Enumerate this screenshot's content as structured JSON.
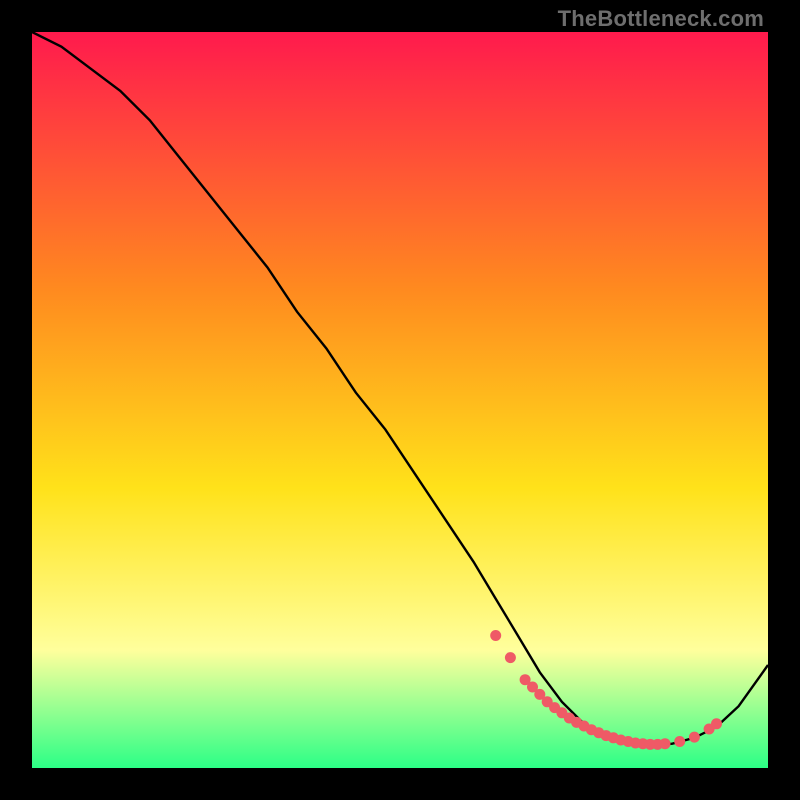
{
  "watermark": "TheBottleneck.com",
  "chart_data": {
    "type": "line",
    "title": "",
    "xlabel": "",
    "ylabel": "",
    "xlim": [
      0,
      100
    ],
    "ylim": [
      0,
      100
    ],
    "grid": false,
    "background_gradient": {
      "top": "#ff1a4d",
      "mid1": "#ff8a1f",
      "mid2": "#ffe21a",
      "mid3": "#ffff9c",
      "bottom": "#2cff86"
    },
    "series": [
      {
        "name": "curve",
        "type": "line",
        "color": "#000000",
        "x": [
          0,
          4,
          8,
          12,
          16,
          20,
          24,
          28,
          32,
          36,
          40,
          44,
          48,
          52,
          56,
          60,
          63,
          66,
          69,
          72,
          75,
          78,
          81,
          84,
          87,
          90,
          93,
          96,
          100
        ],
        "y": [
          100,
          98,
          95,
          92,
          88,
          83,
          78,
          73,
          68,
          62,
          57,
          51,
          46,
          40,
          34,
          28,
          23,
          18,
          13,
          9,
          6,
          4,
          3.2,
          3,
          3.3,
          4.1,
          5.6,
          8.4,
          14
        ]
      },
      {
        "name": "valley-scatter",
        "type": "scatter",
        "color": "#ef5a66",
        "x": [
          63,
          65,
          67,
          68,
          69,
          70,
          71,
          72,
          73,
          74,
          75,
          76,
          77,
          78,
          79,
          80,
          81,
          82,
          83,
          84,
          85,
          86,
          88,
          90,
          92,
          93
        ],
        "y": [
          18,
          15,
          12,
          11,
          10,
          9,
          8.2,
          7.5,
          6.8,
          6.2,
          5.7,
          5.2,
          4.8,
          4.4,
          4.1,
          3.8,
          3.6,
          3.4,
          3.3,
          3.2,
          3.2,
          3.3,
          3.6,
          4.2,
          5.3,
          6.0
        ]
      }
    ]
  }
}
